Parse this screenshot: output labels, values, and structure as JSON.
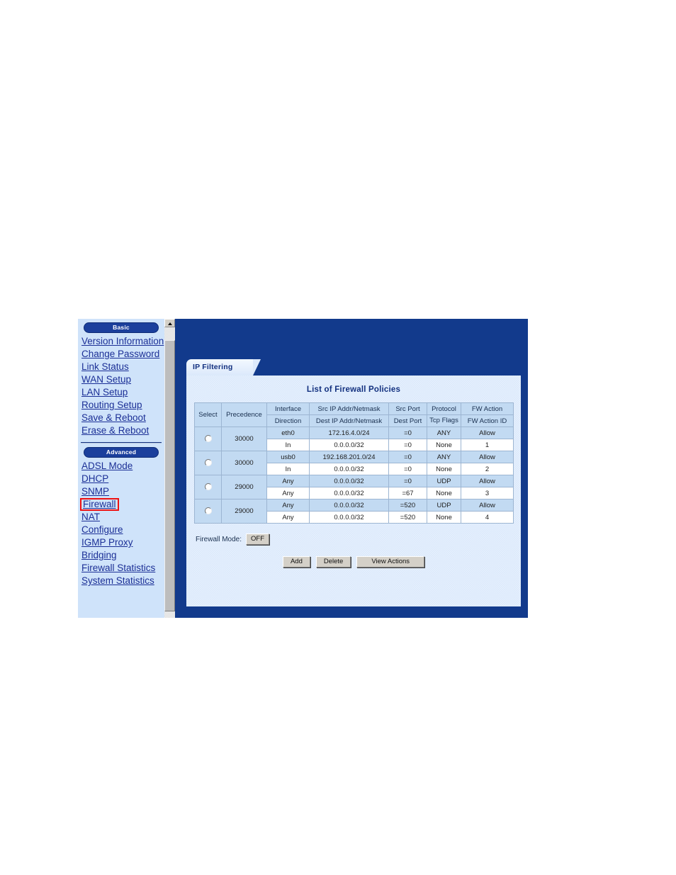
{
  "widget": {
    "sidebar": {
      "basic_pill": "Basic",
      "advanced_pill": "Advanced",
      "basic_items": [
        {
          "label": "Version Information"
        },
        {
          "label": "Change Password"
        },
        {
          "label": "Link Status"
        },
        {
          "label": "WAN Setup"
        },
        {
          "label": "LAN Setup"
        },
        {
          "label": "Routing Setup"
        },
        {
          "label": "Save & Reboot"
        },
        {
          "label": "Erase & Reboot"
        }
      ],
      "advanced_items": [
        {
          "label": "ADSL Mode",
          "highlighted": false
        },
        {
          "label": "DHCP",
          "highlighted": false
        },
        {
          "label": "SNMP",
          "highlighted": false
        },
        {
          "label": "Firewall",
          "highlighted": true
        },
        {
          "label": "NAT",
          "highlighted": false
        },
        {
          "label": "Configure",
          "highlighted": false
        },
        {
          "label": "IGMP Proxy",
          "highlighted": false
        },
        {
          "label": "Bridging",
          "highlighted": false
        },
        {
          "label": "Firewall Statistics",
          "highlighted": false
        },
        {
          "label": "System Statistics",
          "highlighted": false
        }
      ],
      "highlight_color": "#ee1111",
      "link_color": "#1b2f96",
      "background_color": "#cfe3fa"
    },
    "tabs": [
      {
        "label": "IP Filtering",
        "active": true
      }
    ],
    "panel": {
      "title": "List of Firewall Policies",
      "accent_color": "#12307f",
      "header_row_color": "#c2daf2"
    },
    "table": {
      "header_line1": [
        "Select",
        "Precedence",
        "Interface",
        "Src IP Addr/Netmask",
        "Src Port",
        "Protocol",
        "FW Action"
      ],
      "header_line2": [
        "Direction",
        "Dest IP Addr/Netmask",
        "Dest Port",
        "Tcp Flags",
        "FW Action ID"
      ],
      "rows": [
        {
          "select": "",
          "precedence": "30000",
          "interface": "eth0",
          "src_ip": "172.16.4.0/24",
          "src_port": "=0",
          "protocol": "ANY",
          "fw_action": "Allow",
          "direction": "In",
          "dest_ip": "0.0.0.0/32",
          "dest_port": "=0",
          "tcp_flags": "None",
          "fw_action_id": "1"
        },
        {
          "select": "",
          "precedence": "30000",
          "interface": "usb0",
          "src_ip": "192.168.201.0/24",
          "src_port": "=0",
          "protocol": "ANY",
          "fw_action": "Allow",
          "direction": "In",
          "dest_ip": "0.0.0.0/32",
          "dest_port": "=0",
          "tcp_flags": "None",
          "fw_action_id": "2"
        },
        {
          "select": "",
          "precedence": "29000",
          "interface": "Any",
          "src_ip": "0.0.0.0/32",
          "src_port": "=0",
          "protocol": "UDP",
          "fw_action": "Allow",
          "direction": "Any",
          "dest_ip": "0.0.0.0/32",
          "dest_port": "=67",
          "tcp_flags": "None",
          "fw_action_id": "3"
        },
        {
          "select": "",
          "precedence": "29000",
          "interface": "Any",
          "src_ip": "0.0.0.0/32",
          "src_port": "=520",
          "protocol": "UDP",
          "fw_action": "Allow",
          "direction": "Any",
          "dest_ip": "0.0.0.0/32",
          "dest_port": "=520",
          "tcp_flags": "None",
          "fw_action_id": "4"
        }
      ]
    },
    "firewall_mode": {
      "label": "Firewall Mode:",
      "value": "OFF"
    },
    "actions": {
      "add": "Add",
      "delete": "Delete",
      "view_actions": "View Actions"
    }
  }
}
